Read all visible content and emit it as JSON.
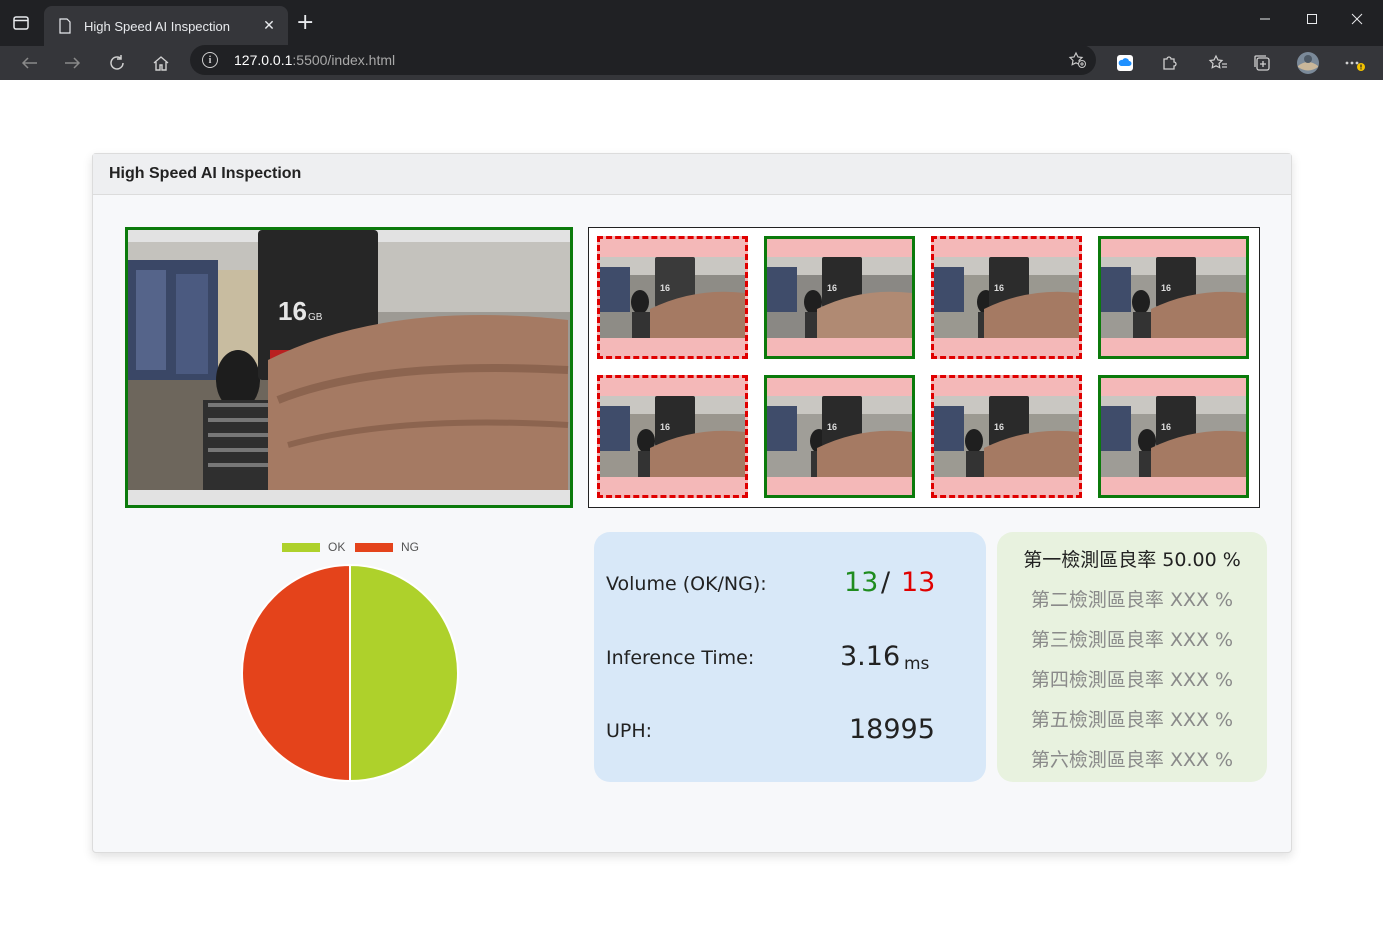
{
  "browser": {
    "tab_title": "High Speed AI Inspection",
    "new_tab_glyph": "+",
    "url_host": "127.0.0.1",
    "url_path": ":5500/index.html"
  },
  "page": {
    "header_title": "High Speed AI Inspection"
  },
  "thumbnails": [
    {
      "status": "NG"
    },
    {
      "status": "OK"
    },
    {
      "status": "NG"
    },
    {
      "status": "OK"
    },
    {
      "status": "NG"
    },
    {
      "status": "OK"
    },
    {
      "status": "NG"
    },
    {
      "status": "OK"
    }
  ],
  "chart_data": {
    "type": "pie",
    "labels": [
      "OK",
      "NG"
    ],
    "values": [
      13,
      13
    ],
    "colors": [
      "#aed12b",
      "#e4431b"
    ],
    "legend_position": "top"
  },
  "stats": {
    "volume_label": "Volume (OK/NG):",
    "ok_count": "13",
    "separator": "/",
    "ng_count": "13",
    "inference_label": "Inference Time:",
    "inference_value": "3.16",
    "inference_unit": "ms",
    "uph_label": "UPH:",
    "uph_value": "18995"
  },
  "yield_rates": [
    "第一檢測區良率 50.00 %",
    "第二檢測區良率 XXX %",
    "第三檢測區良率 XXX %",
    "第四檢測區良率 XXX %",
    "第五檢測區良率 XXX %",
    "第六檢測區良率 XXX %"
  ],
  "colors": {
    "ok_green": "#0b7a0b",
    "ng_red": "#e00000",
    "stats_bg": "#d8e8f8",
    "yield_bg": "#e8f2df"
  }
}
